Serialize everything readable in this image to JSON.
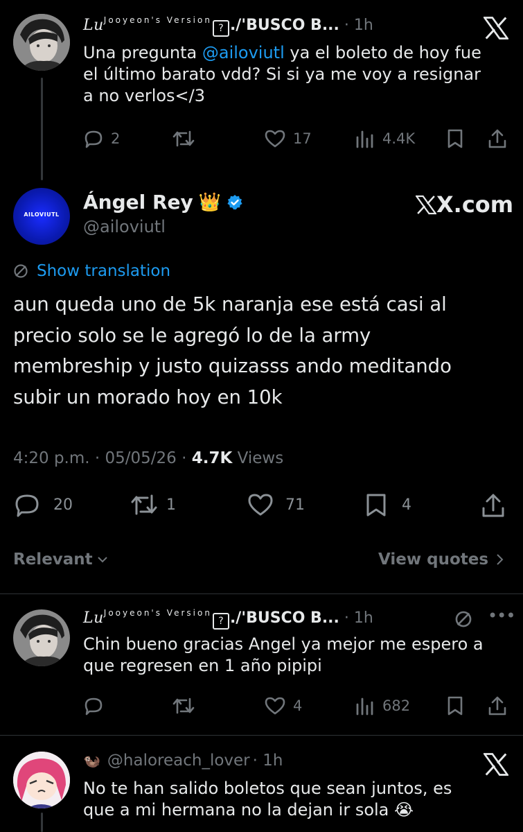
{
  "tweet1": {
    "name_prefix": "Lu",
    "name_sup": "Jooyeon's Version",
    "name_box": "?",
    "name_rest": "./'BUSCO B...",
    "time": "· 1h",
    "text_pre": "Una pregunta ",
    "mention": "@ailoviutl",
    "text_post": " ya el boleto de hoy fue\nel último barato vdd? Si si ya me voy a resignar\na no verlos</3",
    "replies": "2",
    "retweets": "",
    "likes": "17",
    "views": "4.4K"
  },
  "main_tweet": {
    "avatar_text": "AILOVIUTL",
    "name": "Ángel Rey",
    "emoji": "👑",
    "handle": "@ailoviutl",
    "watermark": "X.com",
    "show_translation": "Show translation",
    "text": "aun queda uno de 5k naranja ese está casi al\nprecio solo se le agregó lo de la army\nmembreship y justo quizasss ando meditando\nsubir un morado hoy en 10k",
    "time": "4:20 p.m. · 05/05/26 ·",
    "views_count": "4.7K",
    "views_label": "Views",
    "replies": "20",
    "retweets": "1",
    "likes": "71",
    "bookmarks": "4"
  },
  "sort": {
    "relevant": "Relevant",
    "view_quotes": "View quotes"
  },
  "reply1": {
    "name_prefix": "Lu",
    "name_sup": "Jooyeon's Version",
    "name_box": "?",
    "name_rest": "./'BUSCO B...",
    "time": "· 1h",
    "text": "Chin bueno gracias Angel ya mejor me espero a\nque regresen en 1 año pipipi",
    "replies": "",
    "retweets": "",
    "likes": "4",
    "views": "682"
  },
  "reply2": {
    "handle": "@haloreach_lover",
    "time": "· 1h",
    "text": "No te han salido boletos que sean juntos, es\nque a mi hermana no la dejan ir sola 😭"
  },
  "colors": {
    "background": "#000000",
    "text": "#e7e9ea",
    "muted": "#71767b",
    "link": "#1d9bf0",
    "verified": "#1d9bf0"
  }
}
